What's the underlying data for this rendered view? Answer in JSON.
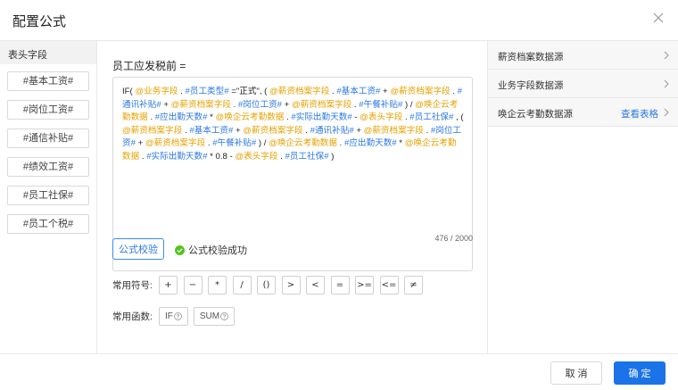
{
  "dialog": {
    "title": "配置公式"
  },
  "fields_panel": {
    "header": "表头字段",
    "items": [
      "#基本工资#",
      "#岗位工资#",
      "#通信补贴#",
      "#绩效工资#",
      "#员工社保#",
      "#员工个税#"
    ]
  },
  "editor": {
    "label": "员工应发税前 =",
    "tokens": [
      {
        "t": "IF( ",
        "c": ""
      },
      {
        "t": "@业务字段",
        "c": "y"
      },
      {
        "t": " . ",
        "c": ""
      },
      {
        "t": "#员工类型#",
        "c": "b"
      },
      {
        "t": " =\"正式\",  ( ",
        "c": ""
      },
      {
        "t": "@薪资档案字段",
        "c": "y"
      },
      {
        "t": " . ",
        "c": ""
      },
      {
        "t": "#基本工资#",
        "c": "b"
      },
      {
        "t": "  +  ",
        "c": ""
      },
      {
        "t": "@薪资档案字段",
        "c": "y"
      },
      {
        "t": " . ",
        "c": ""
      },
      {
        "t": "#通讯补贴#",
        "c": "b"
      },
      {
        "t": "  +  ",
        "c": ""
      },
      {
        "t": "@薪资档案字段",
        "c": "y"
      },
      {
        "t": " . ",
        "c": ""
      },
      {
        "t": "#岗位工资#",
        "c": "b"
      },
      {
        "t": "  +  ",
        "c": ""
      },
      {
        "t": "@薪资档案字段",
        "c": "y"
      },
      {
        "t": " . ",
        "c": ""
      },
      {
        "t": "#午餐补贴#",
        "c": "b"
      },
      {
        "t": " ) / ",
        "c": ""
      },
      {
        "t": "@唤企云考勤数据",
        "c": "y"
      },
      {
        "t": " . ",
        "c": ""
      },
      {
        "t": "#应出勤天数#",
        "c": "b"
      },
      {
        "t": "  *  ",
        "c": ""
      },
      {
        "t": "@唤企云考勤数据",
        "c": "y"
      },
      {
        "t": " . ",
        "c": ""
      },
      {
        "t": "#实际出勤天数#",
        "c": "b"
      },
      {
        "t": "  -  ",
        "c": ""
      },
      {
        "t": "@表头字段",
        "c": "y"
      },
      {
        "t": " . ",
        "c": ""
      },
      {
        "t": "#员工社保#",
        "c": "b"
      },
      {
        "t": "  ,  ( ",
        "c": ""
      },
      {
        "t": "@薪资档案字段",
        "c": "y"
      },
      {
        "t": " . ",
        "c": ""
      },
      {
        "t": "#基本工资#",
        "c": "b"
      },
      {
        "t": "  +  ",
        "c": ""
      },
      {
        "t": "@薪资档案字段",
        "c": "y"
      },
      {
        "t": " . ",
        "c": ""
      },
      {
        "t": "#通讯补贴#",
        "c": "b"
      },
      {
        "t": "  +  ",
        "c": ""
      },
      {
        "t": "@薪资档案字段",
        "c": "y"
      },
      {
        "t": " . ",
        "c": ""
      },
      {
        "t": "#岗位工资#",
        "c": "b"
      },
      {
        "t": "  +  ",
        "c": ""
      },
      {
        "t": "@薪资档案字段",
        "c": "y"
      },
      {
        "t": " . ",
        "c": ""
      },
      {
        "t": "#午餐补贴#",
        "c": "b"
      },
      {
        "t": "  )  /  ",
        "c": ""
      },
      {
        "t": "@唤企云考勤数据",
        "c": "y"
      },
      {
        "t": " . ",
        "c": ""
      },
      {
        "t": "#应出勤天数#",
        "c": "b"
      },
      {
        "t": "  *  ",
        "c": ""
      },
      {
        "t": "@唤企云考勤数据",
        "c": "y"
      },
      {
        "t": " . ",
        "c": ""
      },
      {
        "t": "#实际出勤天数#",
        "c": "b"
      },
      {
        "t": "  * 0.8  -  ",
        "c": ""
      },
      {
        "t": "@表头字段",
        "c": "y"
      },
      {
        "t": " . ",
        "c": ""
      },
      {
        "t": "#员工社保#",
        "c": "b"
      },
      {
        "t": " )",
        "c": ""
      }
    ],
    "counter": "476 / 2000",
    "check_button": "公式校验",
    "check_status": "公式校验成功"
  },
  "symbols": {
    "label": "常用符号:",
    "items": [
      "+",
      "−",
      "*",
      "/",
      "()",
      ">",
      "<",
      "=",
      ">=",
      "<=",
      "≠"
    ]
  },
  "functions": {
    "label": "常用函数:",
    "items": [
      "IF",
      "SUM"
    ]
  },
  "sources": {
    "items": [
      {
        "label": "薪资档案数据源",
        "link": ""
      },
      {
        "label": "业务字段数据源",
        "link": ""
      },
      {
        "label": "唤企云考勤数据源",
        "link": "查看表格"
      }
    ]
  },
  "footer": {
    "cancel": "取 消",
    "confirm": "确 定"
  },
  "colors": {
    "token_source": "#e6a100",
    "token_field": "#2b78e4",
    "primary": "#1a73e8",
    "success": "#52c41a"
  }
}
